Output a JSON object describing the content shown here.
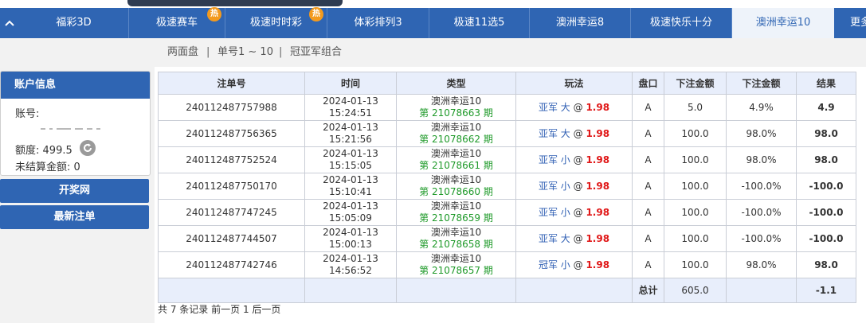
{
  "nav": {
    "tabs": [
      {
        "label": "福彩3D",
        "hot": false
      },
      {
        "label": "极速赛车",
        "hot": true
      },
      {
        "label": "极速时时彩",
        "hot": true
      },
      {
        "label": "体彩排列3",
        "hot": false
      },
      {
        "label": "极速11选5",
        "hot": false
      },
      {
        "label": "澳洲幸运8",
        "hot": false
      },
      {
        "label": "极速快乐十分",
        "hot": false
      },
      {
        "label": "澳洲幸运10",
        "hot": false,
        "active": true
      },
      {
        "label": "更多",
        "hot": false
      }
    ],
    "hot_label": "热",
    "collapse_icon": "chevron-up-icon"
  },
  "subnav": {
    "items": [
      "两面盘",
      "单号1 ~ 10",
      "冠亚军组合"
    ],
    "separator": "|"
  },
  "sidebar": {
    "account_title": "账户信息",
    "account_label": "账号:",
    "credit_label": "额度:",
    "credit_value": "499.5",
    "unsettled_label": "未结算金额:",
    "unsettled_value": "0",
    "draw_button": "开奖网",
    "latest_button": "最新注单"
  },
  "table": {
    "headers": [
      "注单号",
      "时间",
      "类型",
      "玩法",
      "盘口",
      "下注金额",
      "下注金额",
      "结果"
    ],
    "rows": [
      {
        "id": "240112487757988",
        "date": "2024-01-13",
        "time": "15:24:51",
        "game": "澳洲幸运10",
        "period": "第 21078663 期",
        "play": "亚军 大",
        "at": "@",
        "odds": "1.98",
        "pan": "A",
        "amount": "5.0",
        "rebate": "4.9%",
        "result": "4.9",
        "positive": true
      },
      {
        "id": "240112487756365",
        "date": "2024-01-13",
        "time": "15:21:56",
        "game": "澳洲幸运10",
        "period": "第 21078662 期",
        "play": "亚军 大",
        "at": "@",
        "odds": "1.98",
        "pan": "A",
        "amount": "100.0",
        "rebate": "98.0%",
        "result": "98.0",
        "positive": true
      },
      {
        "id": "240112487752524",
        "date": "2024-01-13",
        "time": "15:15:05",
        "game": "澳洲幸运10",
        "period": "第 21078661 期",
        "play": "亚军 小",
        "at": "@",
        "odds": "1.98",
        "pan": "A",
        "amount": "100.0",
        "rebate": "98.0%",
        "result": "98.0",
        "positive": true
      },
      {
        "id": "240112487750170",
        "date": "2024-01-13",
        "time": "15:10:41",
        "game": "澳洲幸运10",
        "period": "第 21078660 期",
        "play": "亚军 小",
        "at": "@",
        "odds": "1.98",
        "pan": "A",
        "amount": "100.0",
        "rebate": "-100.0%",
        "result": "-100.0",
        "positive": false
      },
      {
        "id": "240112487747245",
        "date": "2024-01-13",
        "time": "15:05:09",
        "game": "澳洲幸运10",
        "period": "第 21078659 期",
        "play": "亚军 小",
        "at": "@",
        "odds": "1.98",
        "pan": "A",
        "amount": "100.0",
        "rebate": "-100.0%",
        "result": "-100.0",
        "positive": false
      },
      {
        "id": "240112487744507",
        "date": "2024-01-13",
        "time": "15:00:13",
        "game": "澳洲幸运10",
        "period": "第 21078658 期",
        "play": "亚军 大",
        "at": "@",
        "odds": "1.98",
        "pan": "A",
        "amount": "100.0",
        "rebate": "-100.0%",
        "result": "-100.0",
        "positive": false
      },
      {
        "id": "240112487742746",
        "date": "2024-01-13",
        "time": "14:56:52",
        "game": "澳洲幸运10",
        "period": "第 21078657 期",
        "play": "冠军 小",
        "at": "@",
        "odds": "1.98",
        "pan": "A",
        "amount": "100.0",
        "rebate": "98.0%",
        "result": "98.0",
        "positive": true
      }
    ],
    "total": {
      "label": "总计",
      "amount": "605.0",
      "result": "-1.1"
    }
  },
  "footer": {
    "records": "共 7 条记录",
    "prev": "前一页",
    "page": "1",
    "next": "后一页"
  },
  "colors": {
    "brand_blue": "#2f65b3",
    "header_bg": "#e8eefb",
    "positive": "#3030d0",
    "negative": "#e01818",
    "period_green": "#1f9a2a",
    "hot_badge": "#f39a1e"
  }
}
